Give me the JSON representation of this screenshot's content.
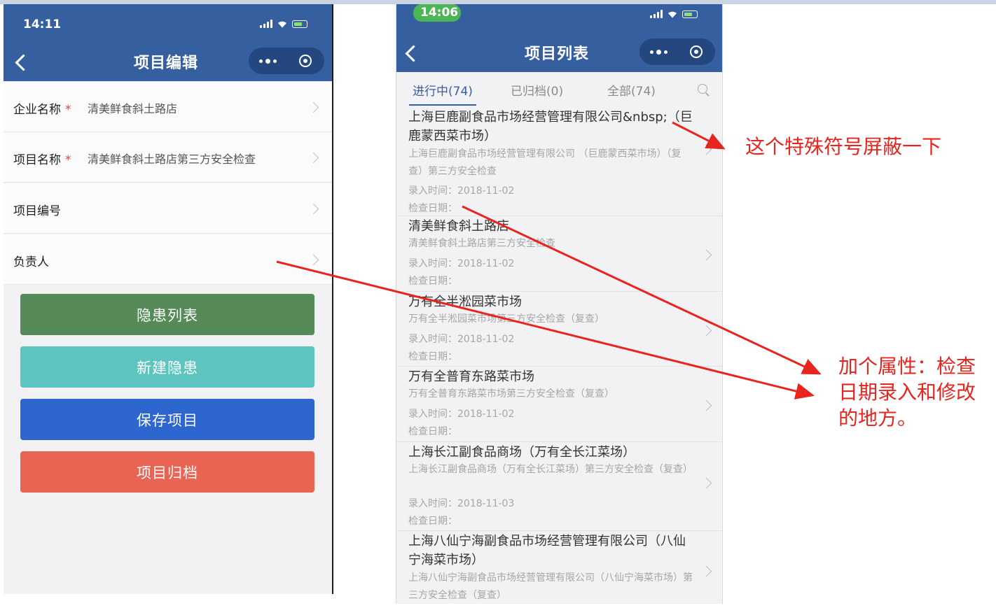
{
  "left_screen": {
    "status_time": "14:11",
    "title": "项目编辑",
    "rows": [
      {
        "label": "企业名称",
        "required": "*",
        "value": "清美鲜食斜土路店"
      },
      {
        "label": "项目名称",
        "required": "*",
        "value": "清美鲜食斜土路店第三方安全检查"
      },
      {
        "label": "项目编号",
        "required": "",
        "value": ""
      },
      {
        "label": "负责人",
        "required": "",
        "value": ""
      }
    ],
    "buttons": [
      {
        "label": "隐患列表",
        "color": "#568a58"
      },
      {
        "label": "新建隐患",
        "color": "#5dc4c0"
      },
      {
        "label": "保存项目",
        "color": "#2e66cf"
      },
      {
        "label": "项目归档",
        "color": "#ea6454"
      }
    ]
  },
  "right_screen": {
    "status_time": "14:06",
    "title": "项目列表",
    "tabs": [
      "进行中(74)",
      "已归档(0)",
      "全部(74)"
    ],
    "items": [
      {
        "title": "上海巨鹿副食品市场经营管理有限公司&nbsp;（巨鹿蒙西菜市场）",
        "subtitle": "上海巨鹿副食品市场经营管理有限公司 （巨鹿蒙西菜市场）（复查）第三方安全检查",
        "entry": "录入时间：2018-11-02",
        "check": "检查日期："
      },
      {
        "title": "清美鲜食斜土路店",
        "subtitle": "清美鲜食斜土路店第三方安全检查",
        "entry": "录入时间：2018-11-02",
        "check": "检查日期："
      },
      {
        "title": "万有全半淞园菜市场",
        "subtitle": "万有全半淞园菜市场第三方安全检查（复查）",
        "entry": "录入时间：2018-11-02",
        "check": "检查日期："
      },
      {
        "title": "万有全普育东路菜市场",
        "subtitle": "万有全普育东路菜市场第三方安全检查（复查）",
        "entry": "录入时间：2018-11-02",
        "check": "检查日期："
      },
      {
        "title": "上海长江副食品商场（万有全长江菜场）",
        "subtitle": "上海长江副食品商场（万有全长江菜场）第三方安全检查（复查）",
        "entry": "录入时间：2018-11-03",
        "check": "检查日期："
      },
      {
        "title": "上海八仙宁海副食品市场经营管理有限公司（八仙宁海菜市场）",
        "subtitle": "上海八仙宁海副食品市场经营管理有限公司（八仙宁海菜市场）第三方安全检查（复查）",
        "entry": "",
        "check": ""
      }
    ]
  },
  "annotations": {
    "note1": "这个特殊符号屏蔽一下",
    "note2": "加个属性：检查日期录入和修改的地方。",
    "color": "#e8241e"
  }
}
